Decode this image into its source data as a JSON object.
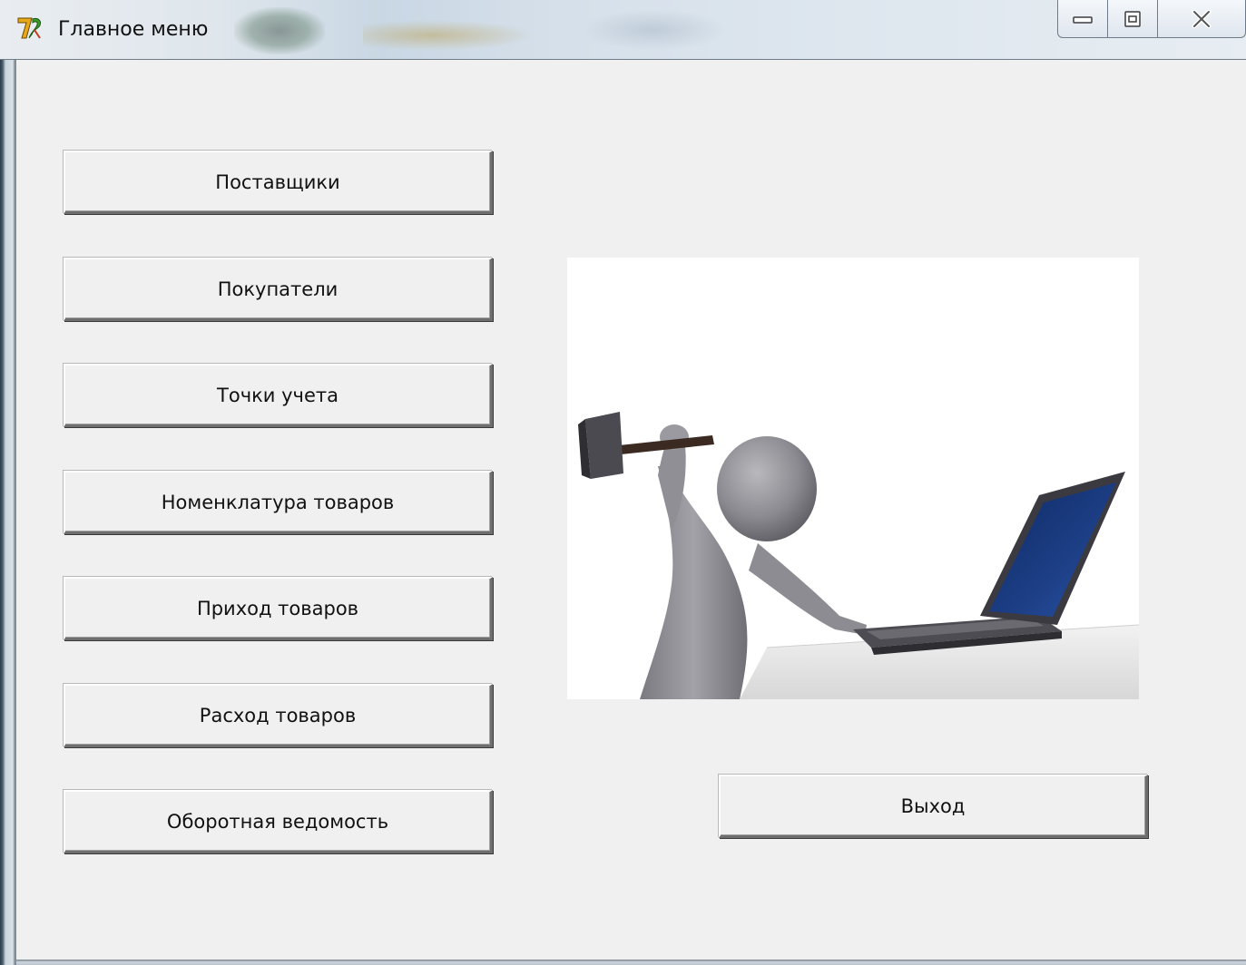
{
  "window": {
    "title": "Главное меню",
    "icon": "app-7-icon",
    "controls": [
      "minimize-icon",
      "maximize-icon",
      "close-icon"
    ]
  },
  "menu": {
    "suppliers": "Поставщики",
    "customers": "Покупатели",
    "accounting_points": "Точки учета",
    "nomenclature": "Номенклатура товаров",
    "goods_receipt": "Приход товаров",
    "goods_expense": "Расход товаров",
    "turnover_statement": "Оборотная ведомость"
  },
  "exit_label": "Выход",
  "illustration": {
    "icon": "figure-with-hammer-and-laptop-illustration"
  },
  "colors": {
    "window_bg": "#f0f0f0",
    "laptop_screen": "#1d3f86"
  }
}
